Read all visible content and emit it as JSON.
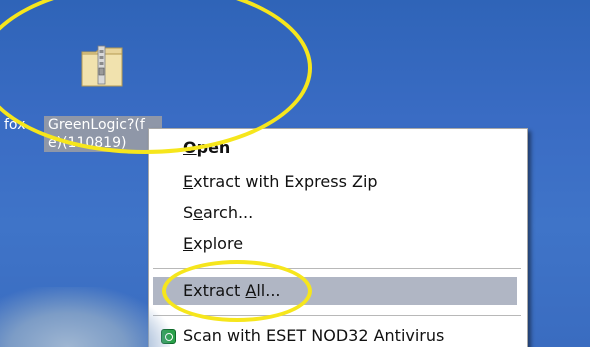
{
  "desktop": {
    "icon_label_left": "fox",
    "icon_label_line1": "GreenLogic?(f",
    "icon_label_line2": "e)(110819)",
    "icon_name": "zip-folder-icon"
  },
  "context_menu": {
    "items": [
      {
        "label_pre": "",
        "label_u": "O",
        "label_post": "pen",
        "bold": true
      },
      {
        "label_pre": "",
        "label_u": "E",
        "label_post": "xtract with Express Zip"
      },
      {
        "label_pre": "S",
        "label_u": "e",
        "label_post": "arch..."
      },
      {
        "label_pre": "",
        "label_u": "E",
        "label_post": "xplore"
      },
      {
        "label_pre": "Extract ",
        "label_u": "A",
        "label_post": "ll..."
      },
      {
        "label_pre": "Scan with ESET NOD32 Antivirus",
        "label_u": "",
        "label_post": ""
      }
    ]
  },
  "colors": {
    "annotation": "#f6e61c",
    "desktop_blue": "#3a6cc4",
    "highlight": "#b0b6c4"
  }
}
